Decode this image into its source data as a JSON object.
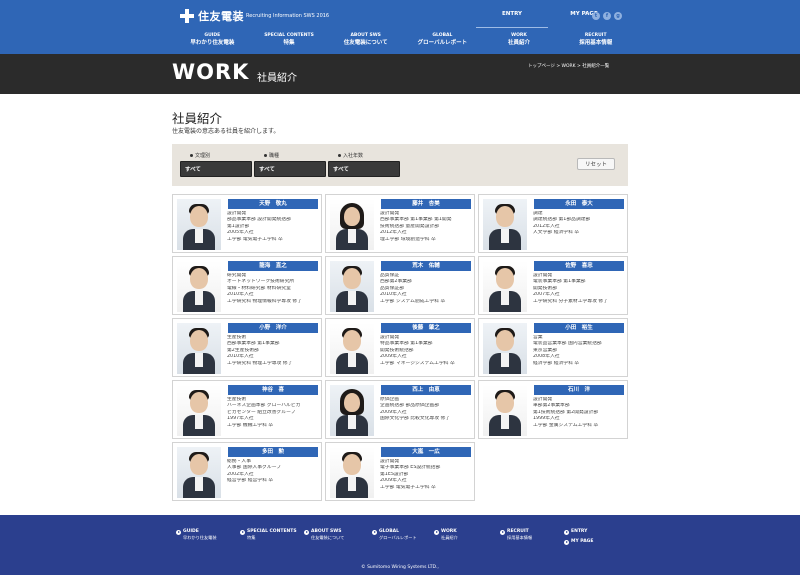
{
  "header": {
    "logo_text": "住友電装",
    "subtitle": "Recruiting Information SWS 2016",
    "top_links": [
      {
        "label": "ENTRY"
      },
      {
        "label": "MY PAGE"
      }
    ],
    "social": [
      "t",
      "f",
      "g"
    ],
    "nav": [
      {
        "en": "GUIDE",
        "jp": "早わかり住友電装"
      },
      {
        "en": "SPECIAL CONTENTS",
        "jp": "特集"
      },
      {
        "en": "ABOUT SWS",
        "jp": "住友電装について"
      },
      {
        "en": "GLOBAL",
        "jp": "グローバルレポート"
      },
      {
        "en": "WORK",
        "jp": "社員紹介"
      },
      {
        "en": "RECRUIT",
        "jp": "採用基本情報"
      }
    ]
  },
  "title_band": {
    "title": "WORK",
    "subtitle": "社員紹介",
    "breadcrumb": "トップページ > WORK > 社員紹介一覧"
  },
  "main": {
    "heading": "社員紹介",
    "lead": "住友電装の意志ある社員を紹介します。",
    "filters": [
      {
        "label": "文理別",
        "value": "すべて"
      },
      {
        "label": "職種",
        "value": "すべて"
      },
      {
        "label": "入社年数",
        "value": "すべて"
      }
    ],
    "reset_label": "リセット"
  },
  "employees": [
    {
      "name": "天野　敬丸",
      "gender": "male",
      "lines": [
        "設計開発",
        "部品事業本部 設計開発統括部",
        "第1設計部",
        "2005年入社",
        "工学部 電気電子工学科 卒"
      ]
    },
    {
      "name": "藤井　杏美",
      "gender": "female",
      "lines": [
        "設計開発",
        "西部事業本部 第1事業部 第1開発",
        "技術統括部 量産開発設計部",
        "2012年入社",
        "理工学部 環境創造学科 卒"
      ]
    },
    {
      "name": "永田　泰大",
      "gender": "male",
      "lines": [
        "調達",
        "調達統括部 第1部品調達部",
        "2012年入社",
        "人文学部 経済学科 卒"
      ]
    },
    {
      "name": "龍海　直之",
      "gender": "male",
      "lines": [
        "研究開発",
        "オートネットワーク技術研究所",
        "電線・材料研究部 材料研究室",
        "2010年入社",
        "工学研究科 物理情報科学専攻 修了"
      ]
    },
    {
      "name": "荒木　佑輔",
      "gender": "male",
      "lines": [
        "品質保証",
        "西部第2事業部",
        "品質保証部",
        "2010年入社",
        "工学部 システム創成工学科 卒"
      ]
    },
    {
      "name": "佐野　喜忠",
      "gender": "male",
      "lines": [
        "設計開発",
        "電装事業本部 第1事業部",
        "開発技術部",
        "2007年入社",
        "工学研究科 分子素材工学専攻 修了"
      ]
    },
    {
      "name": "小野　洋介",
      "gender": "male",
      "lines": [
        "生産技術",
        "西部事業本部 第1事業部",
        "第2生産技術部",
        "2010年入社",
        "工学研究科 物理工学専攻 修了"
      ]
    },
    {
      "name": "後藤　肇之",
      "gender": "male",
      "lines": [
        "設計開発",
        "特品事業本部 第1事業部",
        "開発技術統括部",
        "2009年入社",
        "工学部 マネージシステム工学科 卒"
      ]
    },
    {
      "name": "小田　裕生",
      "gender": "male",
      "lines": [
        "営業",
        "電装品営業本部 国内営業統括部",
        "東京営業部",
        "2008年入社",
        "経済学部 経済学科 卒"
      ]
    },
    {
      "name": "神谷　喜",
      "gender": "male",
      "lines": [
        "生産技術",
        "ハーネス企画本部 グローバルピカ",
        "ピカセンター 組立改善グループ",
        "1997年入社",
        "工学部 機械工学科 卒"
      ]
    },
    {
      "name": "西上　由恵",
      "gender": "female",
      "lines": [
        "原価企画",
        "企画統括部 部品原価企画部",
        "2009年入社",
        "国際文化学部 比較文化専攻 修了"
      ]
    },
    {
      "name": "石川　洋",
      "gender": "male",
      "lines": [
        "設計開発",
        "車部第2事業本部",
        "第1技術統括部 第2開発設計部",
        "1999年入社",
        "工学部 金属システム工学科 卒"
      ]
    },
    {
      "name": "多田　勲",
      "gender": "male",
      "lines": [
        "総務・人事",
        "人事部 国際人事グループ",
        "2002年入社",
        "経営学部 経営学科 卒"
      ]
    },
    {
      "name": "大嵐　一広",
      "gender": "male",
      "lines": [
        "設計開発",
        "電子事業本部 ES設計統括部",
        "第1ES設計部",
        "2009年入社",
        "工学部 電気電子工学科 卒"
      ]
    }
  ],
  "footer": {
    "nav": [
      {
        "en": "GUIDE",
        "jp": "早わかり住友電装"
      },
      {
        "en": "SPECIAL CONTENTS",
        "jp": "特集"
      },
      {
        "en": "ABOUT SWS",
        "jp": "住友電装について"
      },
      {
        "en": "GLOBAL",
        "jp": "グローバルレポート"
      },
      {
        "en": "WORK",
        "jp": "社員紹介"
      },
      {
        "en": "RECRUIT",
        "jp": "採用基本情報"
      },
      {
        "en": "ENTRY",
        "jp": ""
      },
      {
        "en": "MY PAGE",
        "jp": ""
      }
    ],
    "copyright": "© Sumitomo Wiring Systems LTD.,"
  }
}
